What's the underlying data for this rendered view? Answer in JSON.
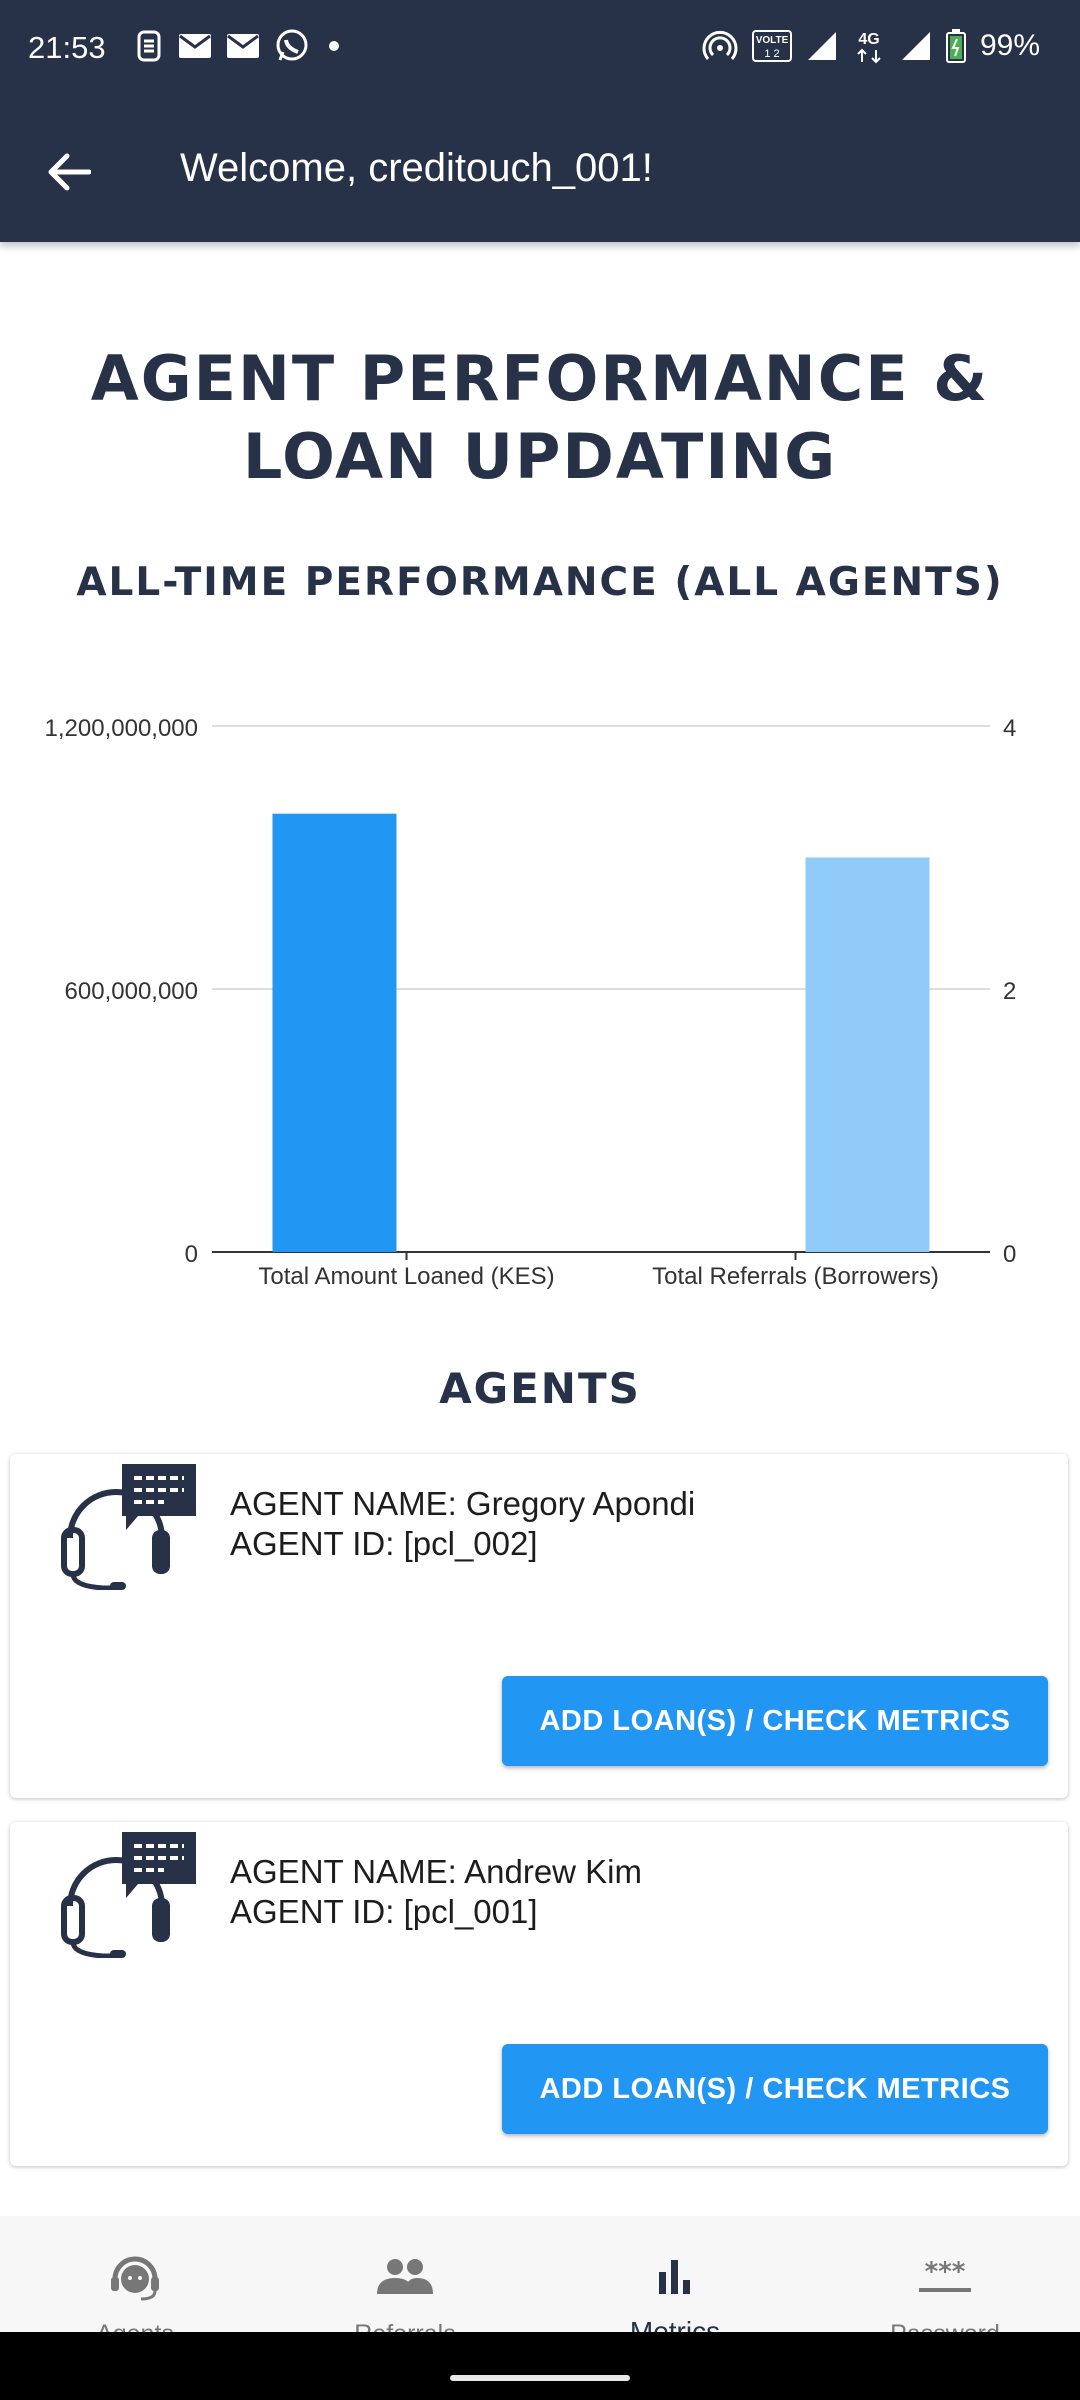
{
  "status_bar": {
    "time": "21:53",
    "battery": "99%",
    "network": "4G",
    "volte": "VOLTE",
    "left_icons": [
      "s-icon",
      "gmail-icon",
      "gmail-icon",
      "whatsapp-icon",
      "dot-icon"
    ],
    "right_icons": [
      "hotspot-icon",
      "volte-icon",
      "signal-icon",
      "4g-icon",
      "signal-icon",
      "battery-icon"
    ]
  },
  "app_bar": {
    "title": "Welcome, creditouch_001!"
  },
  "page": {
    "title_line1": "AGENT PERFORMANCE &",
    "title_line2": "LOAN UPDATING",
    "chart_heading": "ALL-TIME PERFORMANCE (ALL AGENTS)",
    "agents_heading": "AGENTS"
  },
  "chart_data": {
    "type": "bar",
    "categories": [
      "Total Amount Loaned (KES)",
      "Total Referrals (Borrowers)"
    ],
    "series": [
      {
        "axis": "left",
        "color": "#2196f3",
        "values": [
          1000000000,
          null
        ]
      },
      {
        "axis": "right",
        "color": "#90caf9",
        "values": [
          null,
          3
        ]
      }
    ],
    "left_axis": {
      "ticks": [
        "1,200,000,000",
        "600,000,000",
        "0"
      ],
      "range": [
        0,
        1200000000
      ]
    },
    "right_axis": {
      "ticks": [
        "4",
        "2",
        "0"
      ],
      "range": [
        0,
        4
      ]
    },
    "grid": true
  },
  "agents": [
    {
      "name_line": "AGENT NAME: Gregory Apondi",
      "id_line": "AGENT ID: [pcl_002]",
      "button": "ADD LOAN(S) / CHECK METRICS"
    },
    {
      "name_line": "AGENT NAME: Andrew Kim",
      "id_line": "AGENT ID: [pcl_001]",
      "button": "ADD LOAN(S) / CHECK METRICS"
    }
  ],
  "bottom_nav": {
    "items": [
      {
        "label": "Agents",
        "icon": "support-agent-icon"
      },
      {
        "label": "Referrals",
        "icon": "group-icon"
      },
      {
        "label": "Metrics",
        "icon": "bar-chart-icon",
        "active": true
      },
      {
        "label": "Password",
        "icon": "password-icon"
      }
    ]
  },
  "colors": {
    "primary_dark": "#273148",
    "accent": "#2196f3",
    "accent_light": "#90caf9"
  }
}
